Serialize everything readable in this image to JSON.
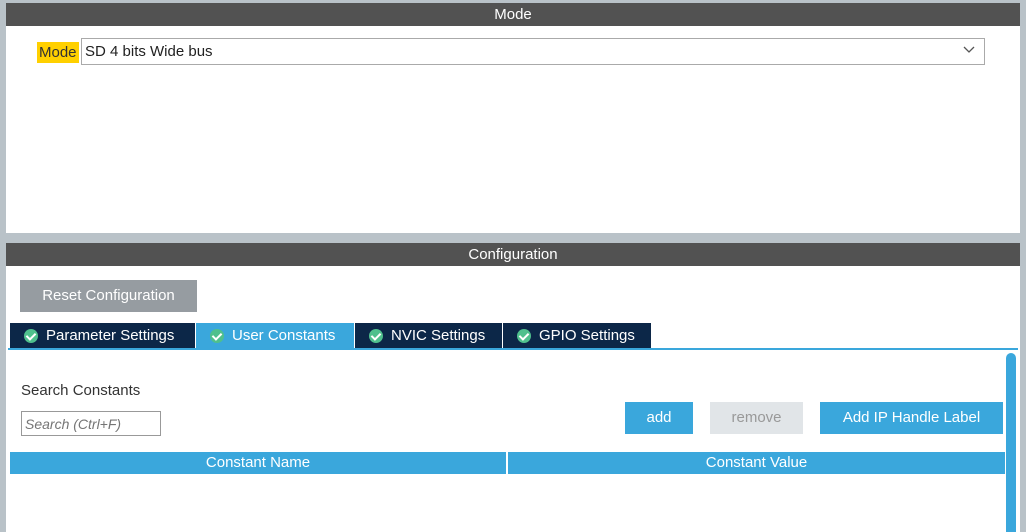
{
  "mode_section": {
    "title": "Mode",
    "mode_label": "Mode",
    "mode_value": "SD 4 bits Wide bus"
  },
  "config_section": {
    "title": "Configuration",
    "reset_label": "Reset Configuration",
    "tabs": [
      {
        "label": "Parameter Settings"
      },
      {
        "label": "User Constants"
      },
      {
        "label": "NVIC Settings"
      },
      {
        "label": "GPIO Settings"
      }
    ],
    "search_label": "Search Constants",
    "search_placeholder": "Search (Ctrl+F)",
    "add_label": "add",
    "remove_label": "remove",
    "add_ip_label": "Add IP Handle Label",
    "columns": [
      "Constant Name",
      "Constant Value"
    ]
  }
}
